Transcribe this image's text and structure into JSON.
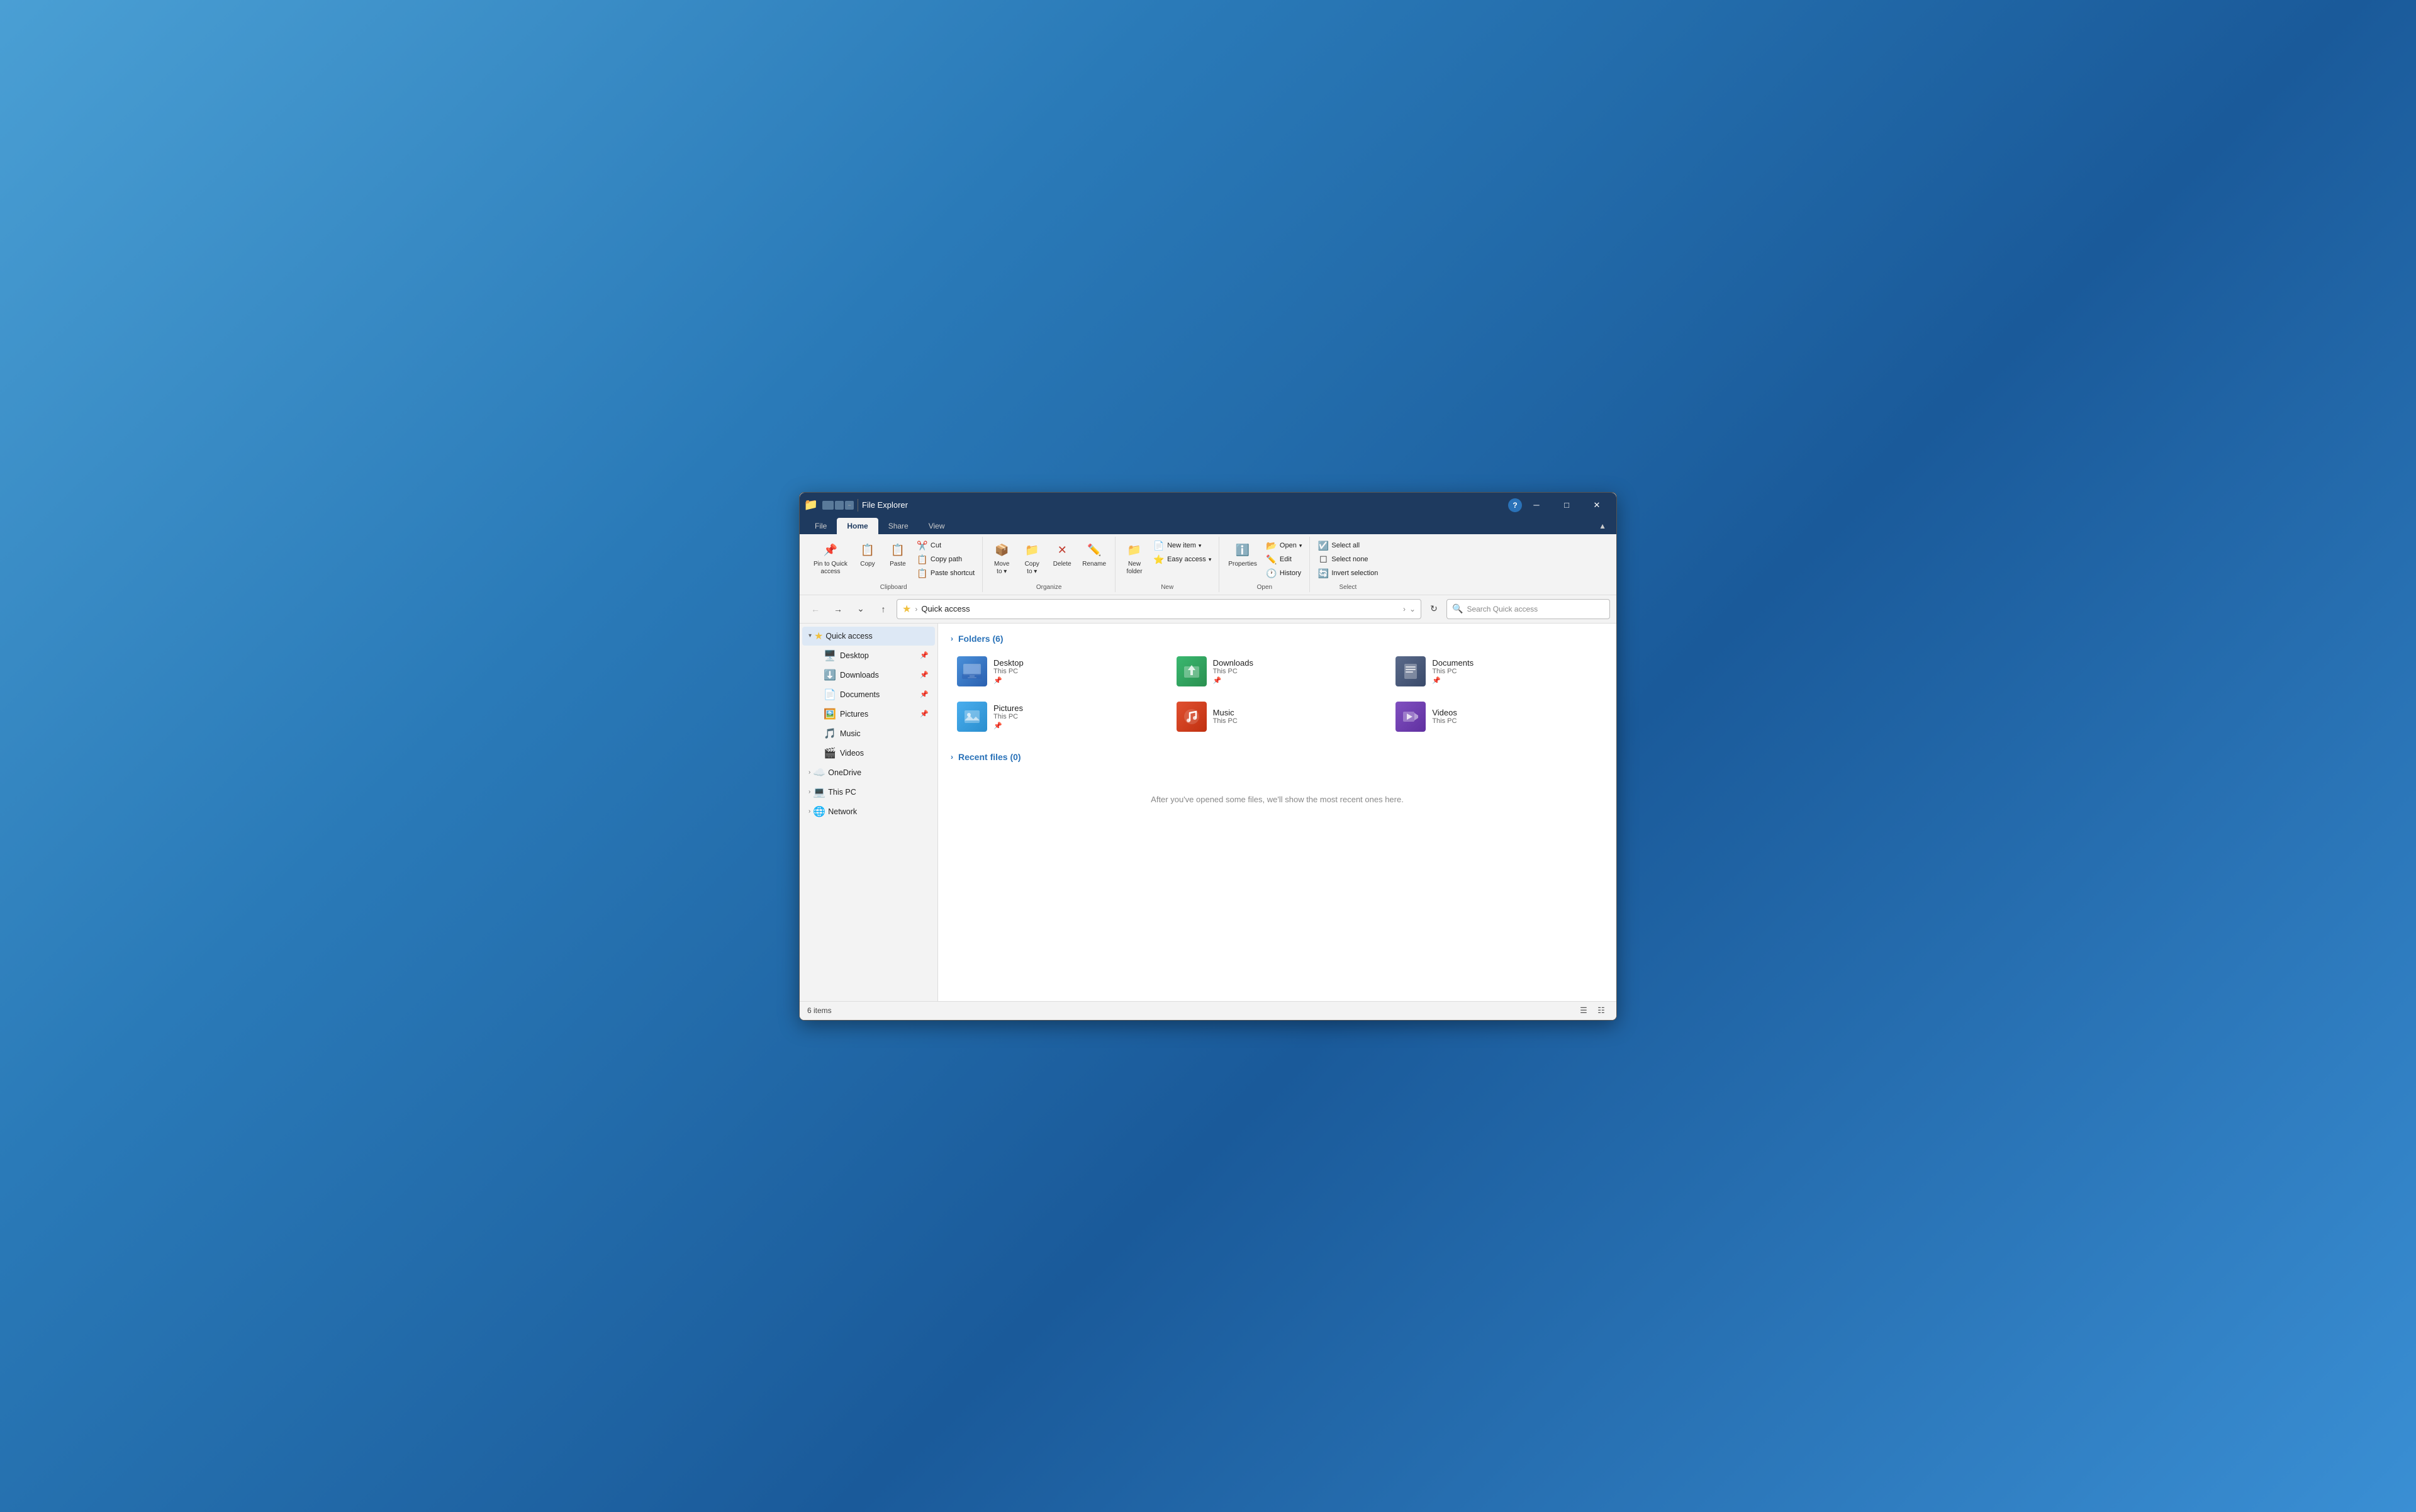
{
  "window": {
    "title": "File Explorer",
    "icon": "📁"
  },
  "titlebar": {
    "controls": {
      "minimize": "─",
      "maximize": "□",
      "close": "✕"
    }
  },
  "ribbon": {
    "tabs": [
      {
        "label": "File",
        "active": false
      },
      {
        "label": "Home",
        "active": true
      },
      {
        "label": "Share",
        "active": false
      },
      {
        "label": "View",
        "active": false
      }
    ],
    "groups": {
      "clipboard": {
        "label": "Clipboard",
        "pin_to_quick_access": "Pin to Quick\naccess",
        "copy": "Copy",
        "paste": "Paste",
        "cut": "Cut",
        "copy_path": "Copy path",
        "paste_shortcut": "Paste shortcut"
      },
      "organize": {
        "label": "Organize",
        "move_to": "Move\nto",
        "copy_to": "Copy\nto",
        "delete": "Delete",
        "rename": "Rename"
      },
      "new": {
        "label": "New",
        "new_folder": "New\nfolder",
        "new_item": "New item",
        "easy_access": "Easy access"
      },
      "open": {
        "label": "Open",
        "properties": "Properties",
        "open": "Open",
        "edit": "Edit",
        "history": "History"
      },
      "select": {
        "label": "Select",
        "select_all": "Select all",
        "select_none": "Select none",
        "invert_selection": "Invert selection"
      }
    }
  },
  "addressbar": {
    "path": "Quick access",
    "search_placeholder": "Search Quick access"
  },
  "sidebar": {
    "quick_access": {
      "label": "Quick access",
      "expanded": true,
      "items": [
        {
          "label": "Desktop",
          "icon": "🖥️",
          "pinned": true
        },
        {
          "label": "Downloads",
          "icon": "⬇️",
          "pinned": true
        },
        {
          "label": "Documents",
          "icon": "📄",
          "pinned": true
        },
        {
          "label": "Pictures",
          "icon": "🖼️",
          "pinned": true
        },
        {
          "label": "Music",
          "icon": "🎵",
          "pinned": false
        },
        {
          "label": "Videos",
          "icon": "🎬",
          "pinned": false
        }
      ]
    },
    "onedrive": {
      "label": "OneDrive",
      "icon": "☁️",
      "expanded": false
    },
    "this_pc": {
      "label": "This PC",
      "icon": "💻",
      "expanded": false
    },
    "network": {
      "label": "Network",
      "icon": "🌐",
      "expanded": false
    }
  },
  "content": {
    "folders_section": {
      "label": "Folders (6)",
      "items": [
        {
          "name": "Desktop",
          "location": "This PC",
          "color": "desktop",
          "icon": "🖥️"
        },
        {
          "name": "Downloads",
          "location": "This PC",
          "color": "downloads",
          "icon": "⬇️"
        },
        {
          "name": "Documents",
          "location": "This PC",
          "color": "documents",
          "icon": "📄"
        },
        {
          "name": "Pictures",
          "location": "This PC",
          "color": "pictures",
          "icon": "🖼️"
        },
        {
          "name": "Music",
          "location": "This PC",
          "color": "music",
          "icon": "🎵"
        },
        {
          "name": "Videos",
          "location": "This PC",
          "color": "videos",
          "icon": "▶️"
        }
      ]
    },
    "recent_section": {
      "label": "Recent files (0)",
      "empty_message": "After you've opened some files, we'll show the most recent ones here."
    }
  },
  "statusbar": {
    "items_count": "6 items"
  }
}
